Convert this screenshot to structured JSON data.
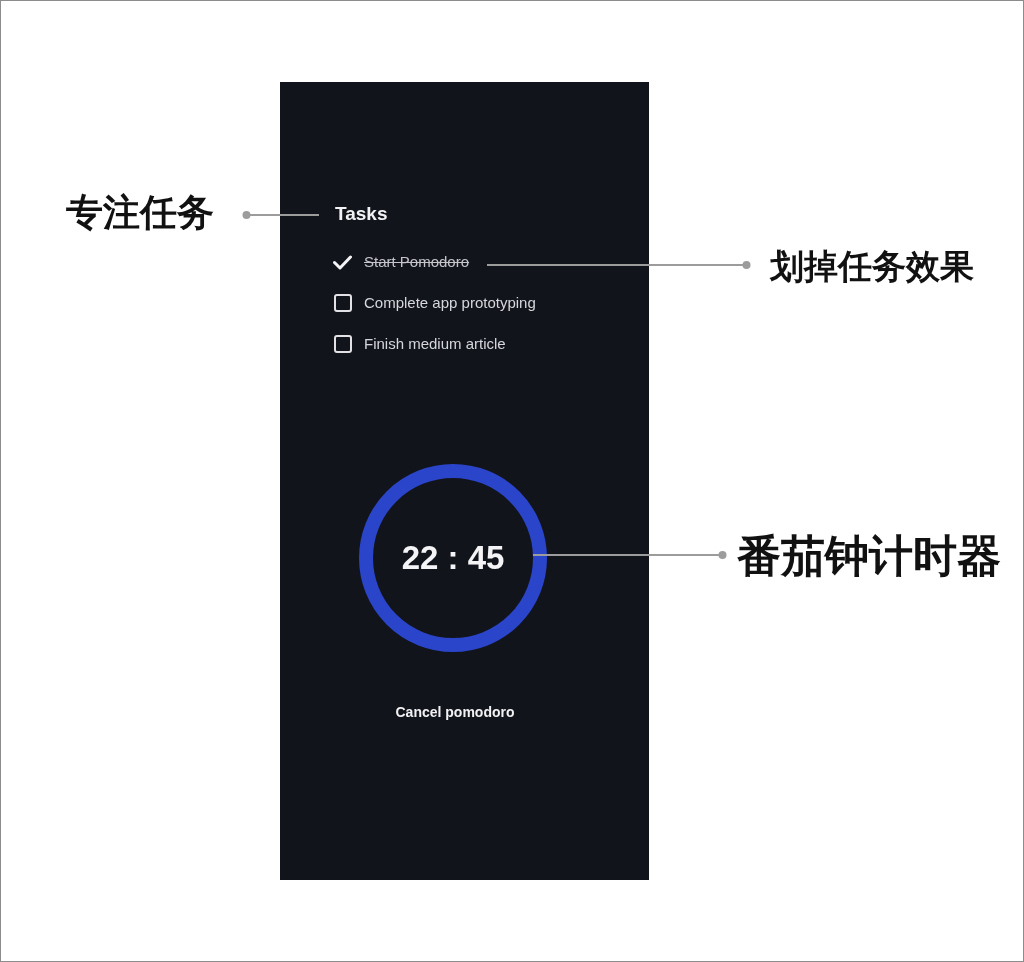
{
  "phone": {
    "tasks_title": "Tasks",
    "tasks": [
      {
        "label": "Start Pomodoro",
        "checked": true
      },
      {
        "label": "Complete app prototyping",
        "checked": false
      },
      {
        "label": "Finish medium article",
        "checked": false
      }
    ],
    "timer": {
      "time": "22 : 45"
    },
    "cancel_button": "Cancel pomodoro"
  },
  "annotations": [
    {
      "kind": "heading",
      "text": "专注任务"
    },
    {
      "kind": "task",
      "text": "划掉任务效果"
    },
    {
      "kind": "timer",
      "text": "番茄钟计时器"
    }
  ]
}
